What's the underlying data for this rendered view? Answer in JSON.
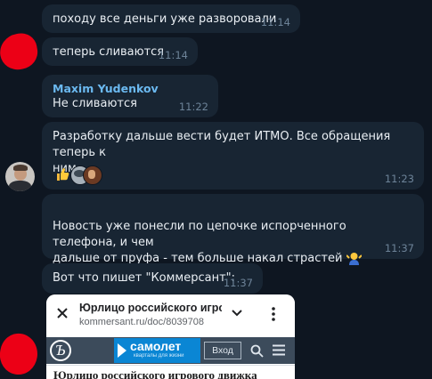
{
  "messages": [
    {
      "text": "походу все деньги уже разворовали",
      "time": "11:14"
    },
    {
      "text": "теперь сливаются",
      "time": "11:14"
    },
    {
      "sender": "Maxim Yudenkov",
      "text": "Не сливаются",
      "time": "11:22"
    },
    {
      "text_line1": "Разработку дальше вести будет ИТМО. Все обращения теперь к",
      "text_line2": "ним",
      "time": "11:23"
    },
    {
      "text_line1": "Новость уже понесли по цепочке испорченного телефона, и чем",
      "text_line2": "дальше от пруфа - тем больше накал страстей",
      "time": "11:37"
    },
    {
      "text": "Вот что пишет \"Коммерсант\":",
      "time": "11:37"
    }
  ],
  "screenshot": {
    "page_title": "Юрлицо российского игро",
    "url": "kommersant.ru/doc/8039708",
    "ad_brand": "самолет",
    "ad_tagline": "кварталы для жизни",
    "login_label": "Вход",
    "headline": "Юрлицо российского игрового движка"
  },
  "icons": [
    "close-icon",
    "chevron-down-icon",
    "more-vert-icon",
    "search-icon",
    "menu-icon",
    "thumbs-up-icon",
    "shrug-icon"
  ],
  "colors": {
    "background": "#0e1621",
    "bubble": "#182533",
    "sender": "#6bb9f0",
    "time": "#6d8398",
    "redaction": "#ec0016"
  }
}
